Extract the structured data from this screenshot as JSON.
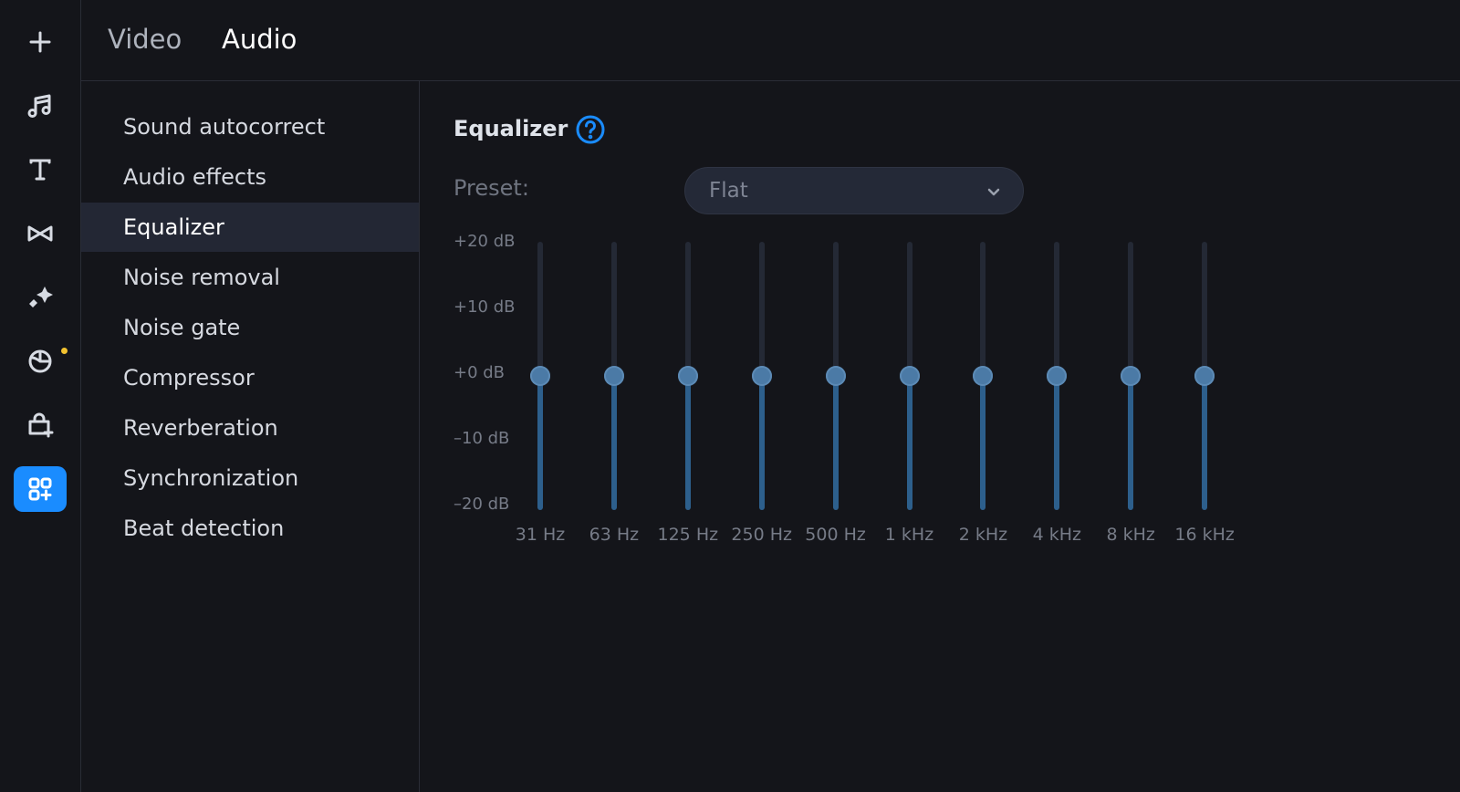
{
  "rail": {
    "items": [
      {
        "icon": "plus-icon"
      },
      {
        "icon": "music-note-icon"
      },
      {
        "icon": "text-icon"
      },
      {
        "icon": "transitions-icon"
      },
      {
        "icon": "magic-sparkle-icon"
      },
      {
        "icon": "sticker-icon",
        "notification": true
      },
      {
        "icon": "store-bag-icon"
      },
      {
        "icon": "more-tools-icon",
        "active": true
      }
    ],
    "accent": "#1a8cff",
    "notification_color": "#f2c230"
  },
  "tabs": [
    {
      "label": "Video",
      "active": false
    },
    {
      "label": "Audio",
      "active": true
    }
  ],
  "effects": [
    {
      "label": "Sound autocorrect",
      "selected": false
    },
    {
      "label": "Audio effects",
      "selected": false
    },
    {
      "label": "Equalizer",
      "selected": true
    },
    {
      "label": "Noise removal",
      "selected": false
    },
    {
      "label": "Noise gate",
      "selected": false
    },
    {
      "label": "Compressor",
      "selected": false
    },
    {
      "label": "Reverberation",
      "selected": false
    },
    {
      "label": "Synchronization",
      "selected": false
    },
    {
      "label": "Beat detection",
      "selected": false
    }
  ],
  "equalizer": {
    "title": "Equalizer",
    "help_icon": "question-circle-icon",
    "preset_label": "Preset:",
    "preset_value": "Flat",
    "db_range": [
      -20,
      20
    ],
    "db_labels": [
      "+20 dB",
      "+10 dB",
      "+0 dB",
      "–10 dB",
      "–20 dB"
    ],
    "bands": [
      {
        "freq": "31 Hz",
        "gain_db": 0
      },
      {
        "freq": "63 Hz",
        "gain_db": 0
      },
      {
        "freq": "125 Hz",
        "gain_db": 0
      },
      {
        "freq": "250 Hz",
        "gain_db": 0
      },
      {
        "freq": "500 Hz",
        "gain_db": 0
      },
      {
        "freq": "1 kHz",
        "gain_db": 0
      },
      {
        "freq": "2 kHz",
        "gain_db": 0
      },
      {
        "freq": "4 kHz",
        "gain_db": 0
      },
      {
        "freq": "8 kHz",
        "gain_db": 0
      },
      {
        "freq": "16 kHz",
        "gain_db": 0
      }
    ]
  }
}
